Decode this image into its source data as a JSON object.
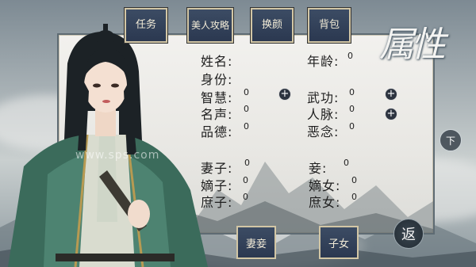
{
  "tabs": [
    {
      "label": "任务"
    },
    {
      "label": "美人攻略"
    },
    {
      "label": "换颜"
    },
    {
      "label": "背包"
    }
  ],
  "title_calligraphy": "属性",
  "watermark": "www.sps.com",
  "fields": {
    "name_label": "姓名:",
    "age_label": "年龄:",
    "age_value": "0",
    "identity_label": "身份:",
    "wisdom_label": "智慧:",
    "wisdom_value": "0",
    "martial_label": "武功:",
    "martial_value": "0",
    "fame_label": "名声:",
    "fame_value": "0",
    "network_label": "人脉:",
    "network_value": "0",
    "virtue_label": "品德:",
    "virtue_value": "0",
    "evil_label": "恶念:",
    "evil_value": "0",
    "wife_label": "妻子:",
    "wife_value": "0",
    "concubine_label": "妾:",
    "concubine_value": "0",
    "legit_son_label": "嫡子:",
    "legit_son_value": "0",
    "legit_daughter_label": "嫡女:",
    "legit_daughter_value": "0",
    "base_son_label": "庶子:",
    "base_son_value": "0",
    "base_daughter_label": "庶女:",
    "base_daughter_value": "0"
  },
  "plus_symbol": "+",
  "bottom_buttons": {
    "spouses": "妻妾",
    "children": "子女"
  },
  "down_label": "下",
  "back_label": "返",
  "colors": {
    "button_bg": "#34435b",
    "button_border": "#d2c6a5",
    "panel_bg": "#eeede9"
  }
}
